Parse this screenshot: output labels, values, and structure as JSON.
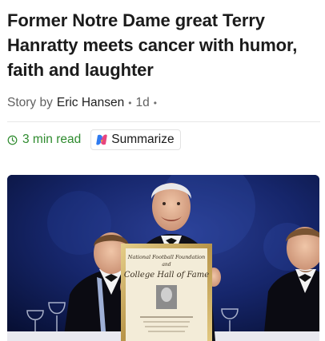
{
  "article": {
    "headline": "Former Notre Dame great Terry Hanratty meets cancer with humor, faith and laughter",
    "byline_prefix": "Story by",
    "author": "Eric Hansen",
    "age": "1d",
    "read_time": "3 min read",
    "summarize_label": "Summarize",
    "hero_image": {
      "plaque_lines": [
        "National Football Foundation",
        "and",
        "College Hall of Fame"
      ]
    }
  },
  "colors": {
    "read_time": "#2e8b2e",
    "hero_background": "#0e1a4a"
  },
  "icons": {
    "read_time": "clock-icon",
    "summarize": "copilot-icon"
  }
}
